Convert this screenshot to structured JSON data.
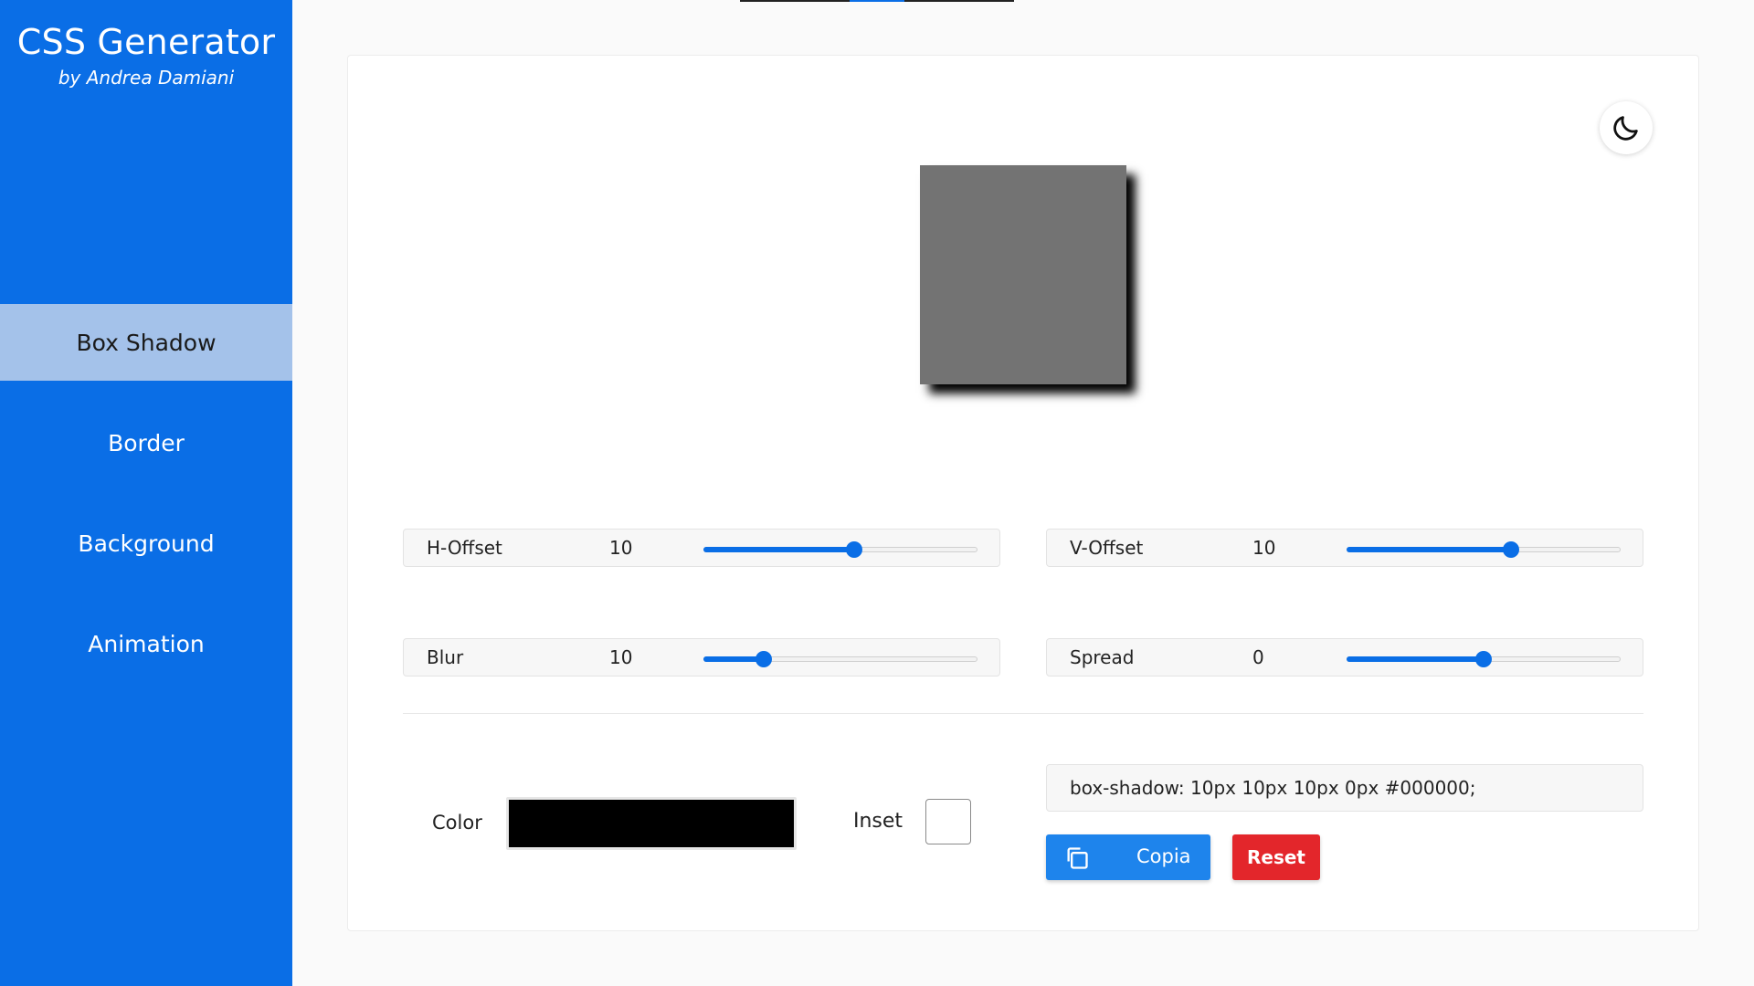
{
  "brand": {
    "title": "CSS Generator",
    "subtitle": "by Andrea Damiani"
  },
  "nav": {
    "items": [
      {
        "label": "Box Shadow",
        "active": true
      },
      {
        "label": "Border",
        "active": false
      },
      {
        "label": "Background",
        "active": false
      },
      {
        "label": "Animation",
        "active": false
      }
    ]
  },
  "theme": {
    "icon": "moon-icon"
  },
  "controls": {
    "h_offset": {
      "label": "H-Offset",
      "value": "10",
      "fill_fraction": 0.55
    },
    "v_offset": {
      "label": "V-Offset",
      "value": "10",
      "fill_fraction": 0.6
    },
    "blur": {
      "label": "Blur",
      "value": "10",
      "fill_fraction": 0.22
    },
    "spread": {
      "label": "Spread",
      "value": "0",
      "fill_fraction": 0.5
    }
  },
  "color": {
    "label": "Color",
    "value": "#000000"
  },
  "inset": {
    "label": "Inset",
    "checked": false
  },
  "output": {
    "css": "box-shadow: 10px 10px 10px 0px #000000;"
  },
  "buttons": {
    "copy_label": "Copia",
    "copy_icon": "copy-icon",
    "reset_label": "Reset"
  },
  "colors": {
    "sidebar": "#0a6ee6",
    "active_nav": "#a4c2ea",
    "slider": "#0a6ee6",
    "copy_button": "#1e84ec",
    "reset_button": "#e3262b",
    "preview_box": "#737373"
  }
}
